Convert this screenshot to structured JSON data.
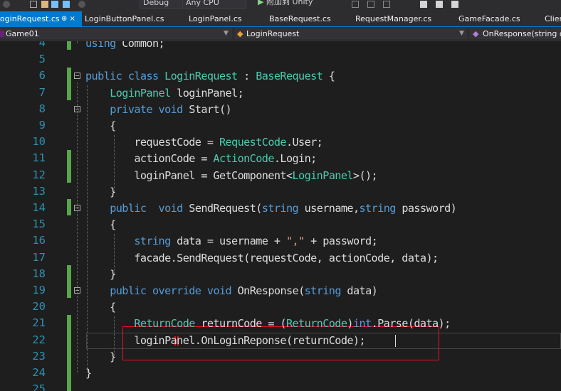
{
  "toolbar": {
    "config": "Debug",
    "platform": "Any CPU",
    "attach_label": "附加到 Unity"
  },
  "tabs": [
    {
      "label": "LoginRequest.cs",
      "pin": "⊕ ×"
    },
    {
      "label": "LoginButtonPanel.cs"
    },
    {
      "label": "LoginPanel.cs"
    },
    {
      "label": "BaseRequest.cs"
    },
    {
      "label": "RequestManager.cs"
    },
    {
      "label": "GameFacade.cs"
    },
    {
      "label": "Clier"
    }
  ],
  "navbar": {
    "project": "Game01",
    "class": "LoginRequest",
    "member": "OnResponse(string da"
  },
  "colors": {
    "accent": "#007acc",
    "keyword": "#569cd6",
    "type": "#4ec9b0",
    "string": "#d69d85",
    "line_number": "#2b91af",
    "change_marker": "#57a64a",
    "highlight_box": "#e81123"
  },
  "editor": {
    "lines": [
      {
        "num": "4",
        "html": "<span class='kw'>using</span> Common;"
      },
      {
        "num": "5",
        "html": ""
      },
      {
        "num": "6",
        "html": "<span class='kw'>public</span> <span class='kw'>class</span> <span class='ty'>LoginRequest</span> : <span class='ty'>BaseRequest</span> {"
      },
      {
        "num": "7",
        "html": "    <span class='ty'>LoginPanel</span> loginPanel;"
      },
      {
        "num": "8",
        "html": "    <span class='kw'>private</span> <span class='kw'>void</span> Start()"
      },
      {
        "num": "9",
        "html": "    {"
      },
      {
        "num": "10",
        "html": "        requestCode = <span class='ty'>RequestCode</span>.User;"
      },
      {
        "num": "11",
        "html": "        actionCode = <span class='ty'>ActionCode</span>.Login;"
      },
      {
        "num": "12",
        "html": "        loginPanel = GetComponent&lt;<span class='ty'>LoginPanel</span>&gt;();"
      },
      {
        "num": "13",
        "html": "    }"
      },
      {
        "num": "14",
        "html": "    <span class='kw'>public</span>  <span class='kw'>void</span> SendRequest(<span class='kw'>string</span> username,<span class='kw'>string</span> password)"
      },
      {
        "num": "15",
        "html": "    {"
      },
      {
        "num": "16",
        "html": "        <span class='kw'>string</span> data = username + <span class='st'>\",\"</span> + password;"
      },
      {
        "num": "17",
        "html": "        facade.SendRequest(requestCode, actionCode, data);"
      },
      {
        "num": "18",
        "html": "    }"
      },
      {
        "num": "19",
        "html": "    <span class='kw'>public</span> <span class='kw'>override</span> <span class='kw'>void</span> OnResponse(<span class='kw'>string</span> data)"
      },
      {
        "num": "20",
        "html": "    {"
      },
      {
        "num": "21",
        "html": "        <span class='ty'>ReturnCode</span> returnCode = (<span class='ty'>ReturnCode</span>)<span class='kw'>int</span>.Parse(data);"
      },
      {
        "num": "22",
        "html": "        loginPanel.OnLoginReponse(returnCode);"
      },
      {
        "num": "23",
        "html": "    }"
      },
      {
        "num": "24",
        "html": "}"
      },
      {
        "num": "25",
        "html": ""
      }
    ]
  }
}
